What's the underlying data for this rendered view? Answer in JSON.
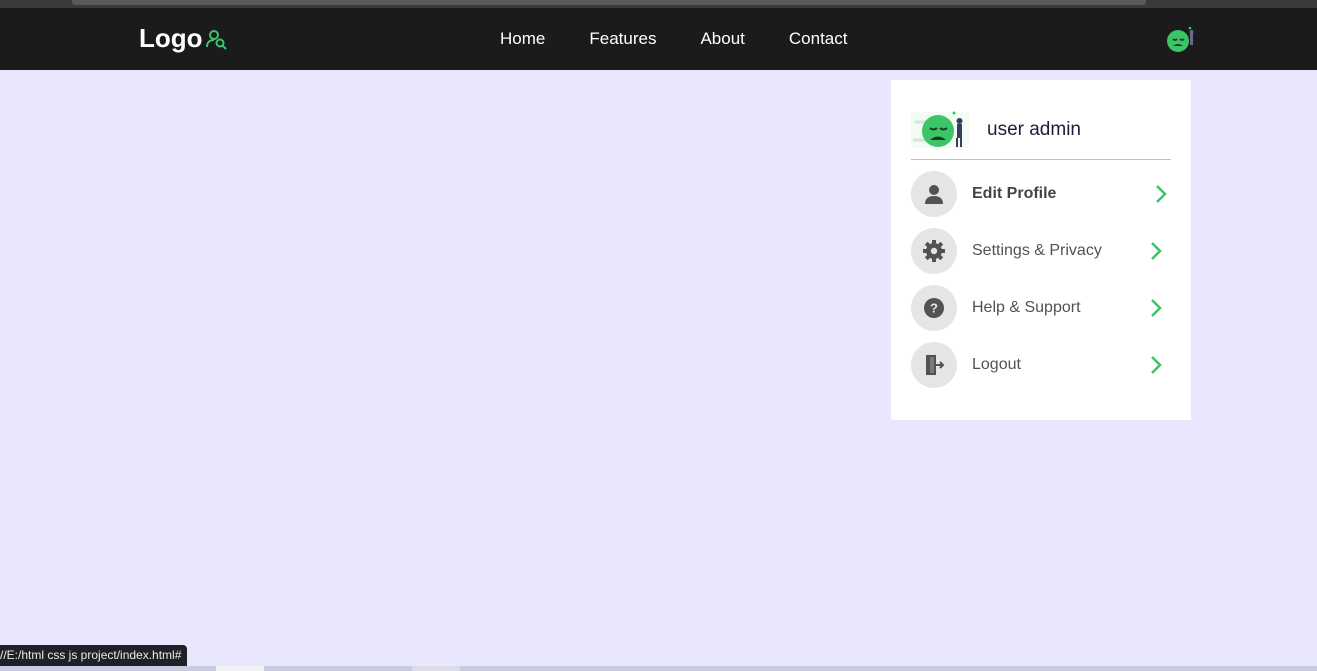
{
  "navbar": {
    "logo_text": "Logo",
    "links": [
      "Home",
      "Features",
      "About",
      "Contact"
    ],
    "accent": "#3cc467"
  },
  "profile_menu": {
    "user_name": "user admin",
    "items": [
      {
        "label": "Edit Profile",
        "icon": "person-icon"
      },
      {
        "label": "Settings & Privacy",
        "icon": "gear-icon"
      },
      {
        "label": "Help & Support",
        "icon": "help-icon"
      },
      {
        "label": "Logout",
        "icon": "logout-icon"
      }
    ]
  },
  "status_bar": {
    "url": "//E:/html css js project/index.html#"
  },
  "colors": {
    "page_bg": "#e9e7fd",
    "navbar_bg": "#1b1b1b",
    "chevron": "#3cc467"
  }
}
